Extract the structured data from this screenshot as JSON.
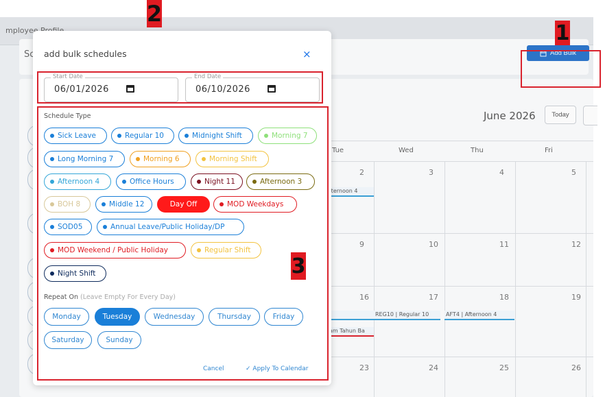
{
  "background": {
    "breadcrumb": "mployee Profile",
    "card_label": "Sc",
    "add_bulk_label": "Add Bulk",
    "calendar": {
      "title": "June 2026",
      "today_label": "Today",
      "weekdays": [
        "Tue",
        "Wed",
        "Thu",
        "Fri"
      ],
      "weeks": [
        [
          "2",
          "3",
          "4",
          "5"
        ],
        [
          "9",
          "10",
          "11",
          "12"
        ],
        [
          "16",
          "17",
          "18",
          "19"
        ],
        [
          "23",
          "24",
          "25",
          "26"
        ]
      ],
      "events": [
        {
          "label": "fternoon 4",
          "color": "#3a9fd5"
        },
        {
          "label": "",
          "color": "#3a9fd5"
        },
        {
          "label": "REG10 | Regular 10",
          "color": "#3a9fd5"
        },
        {
          "label": "AFT4 | Afternoon 4",
          "color": "#3a9fd5"
        },
        {
          "label": "am Tahun Ba",
          "color": "#d9232e"
        }
      ]
    }
  },
  "annotations": [
    "1",
    "2",
    "3"
  ],
  "modal": {
    "title": "add bulk schedules",
    "close_icon": "×",
    "start_date": {
      "label": "Start Date",
      "value": "06/01/2026"
    },
    "end_date": {
      "label": "End Date",
      "value": "06/10/2026"
    },
    "schedule_type_label": "Schedule Type",
    "schedule_types": [
      {
        "label": "Sick Leave",
        "color": "#1a7fd8"
      },
      {
        "label": "Regular 10",
        "color": "#1a7fd8"
      },
      {
        "label": "Midnight Shift",
        "color": "#1a7fd8"
      },
      {
        "label": "Morning 7",
        "color": "#8ee07a"
      },
      {
        "label": "Long Morning 7",
        "color": "#1a7fd8"
      },
      {
        "label": "Morning 6",
        "color": "#f0a020"
      },
      {
        "label": "Morning Shift",
        "color": "#f3c340"
      },
      {
        "label": "Afternoon 4",
        "color": "#33a6d8"
      },
      {
        "label": "Office Hours",
        "color": "#1a7fd8"
      },
      {
        "label": "Night 11",
        "color": "#7a1020"
      },
      {
        "label": "Afternoon 3",
        "color": "#7a6a10"
      },
      {
        "label": "BOH 8",
        "color": "#d8c89a"
      },
      {
        "label": "Middle 12",
        "color": "#1a7fd8"
      },
      {
        "label": "Day Off",
        "color": "#ff1a1a",
        "selected": true
      },
      {
        "label": "MOD Weekdays",
        "color": "#e01b22"
      },
      {
        "label": "SOD05",
        "color": "#1a7fd8"
      },
      {
        "label": "Annual Leave/Public Holiday/DP",
        "color": "#1a7fd8"
      },
      {
        "label": "MOD Weekend / Public Holiday",
        "color": "#e01b22"
      },
      {
        "label": "Regular Shift",
        "color": "#f3c340"
      },
      {
        "label": "Night Shift",
        "color": "#0d2a5c"
      }
    ],
    "repeat_on_label": "Repeat On",
    "repeat_on_hint": "(Leave Empty For Every Day)",
    "days": [
      {
        "label": "Monday",
        "selected": false
      },
      {
        "label": "Tuesday",
        "selected": true
      },
      {
        "label": "Wednesday",
        "selected": false
      },
      {
        "label": "Thursday",
        "selected": false
      },
      {
        "label": "Friday",
        "selected": false
      },
      {
        "label": "Saturday",
        "selected": false
      },
      {
        "label": "Sunday",
        "selected": false
      }
    ],
    "cancel_label": "Cancel",
    "apply_label": "Apply To Calendar"
  }
}
